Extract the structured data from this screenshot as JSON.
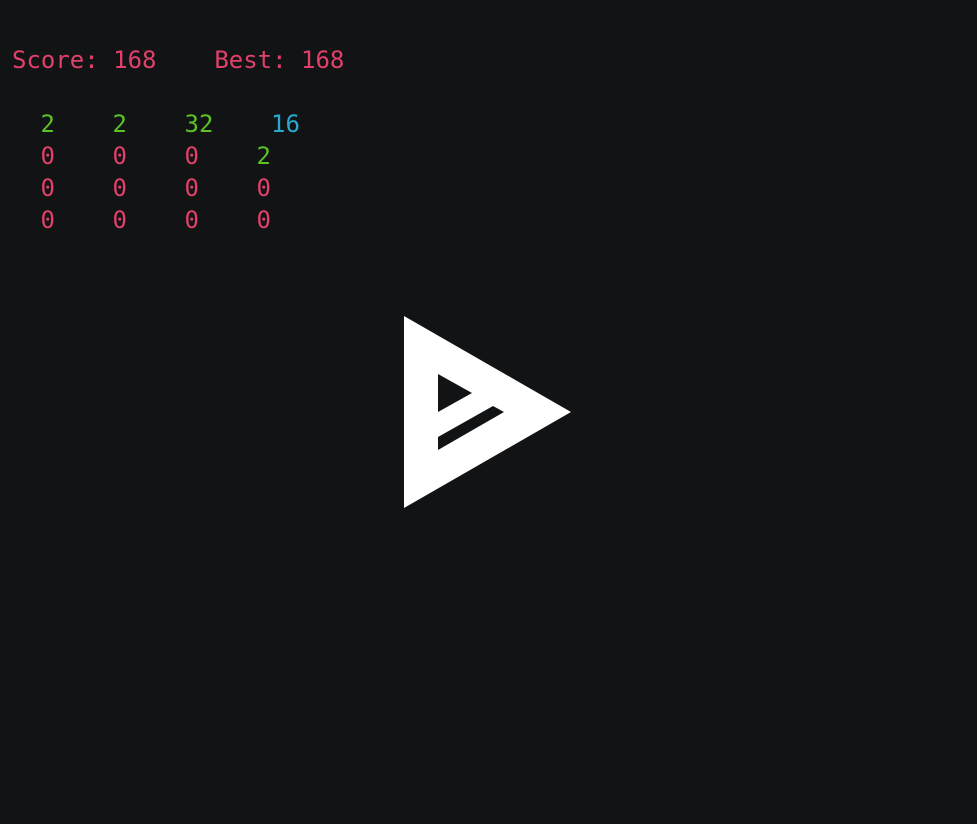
{
  "score": {
    "score_label": "Score:",
    "score_value": "168",
    "best_label": "Best:",
    "best_value": "168"
  },
  "grid": {
    "rows": [
      [
        "2",
        "2",
        "32",
        "16"
      ],
      [
        "0",
        "0",
        "0",
        "2"
      ],
      [
        "0",
        "0",
        "0",
        "0"
      ],
      [
        "0",
        "0",
        "0",
        "0"
      ]
    ]
  },
  "colors": {
    "background": "#121314",
    "score_text": "#e0406a",
    "zero_tile": "#e0406a",
    "small_tile": "#5cc226",
    "sixteen_tile": "#2aa8d0",
    "logo": "#ffffff"
  },
  "icons": {
    "center_logo": "play-triangle-logo-icon"
  }
}
